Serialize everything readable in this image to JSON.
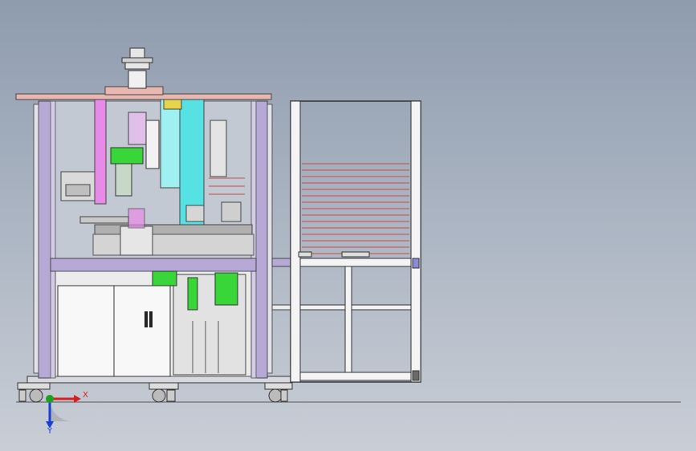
{
  "triad": {
    "x_label": "X",
    "y_label": "Y",
    "x_color": "#d81e1e",
    "y_color": "#1a3fd6",
    "origin_color": "#1fa01f"
  },
  "model": {
    "frame_color": "#b7a9d6",
    "glass_color": "#c2c9d2",
    "top_plate_color": "#e9b7b1",
    "accent_colors": {
      "magenta": "#e88be8",
      "cyan": "#56e2e2",
      "green": "#39d639",
      "yellow": "#e6d44a",
      "red_lines": "#c84b4b"
    }
  }
}
